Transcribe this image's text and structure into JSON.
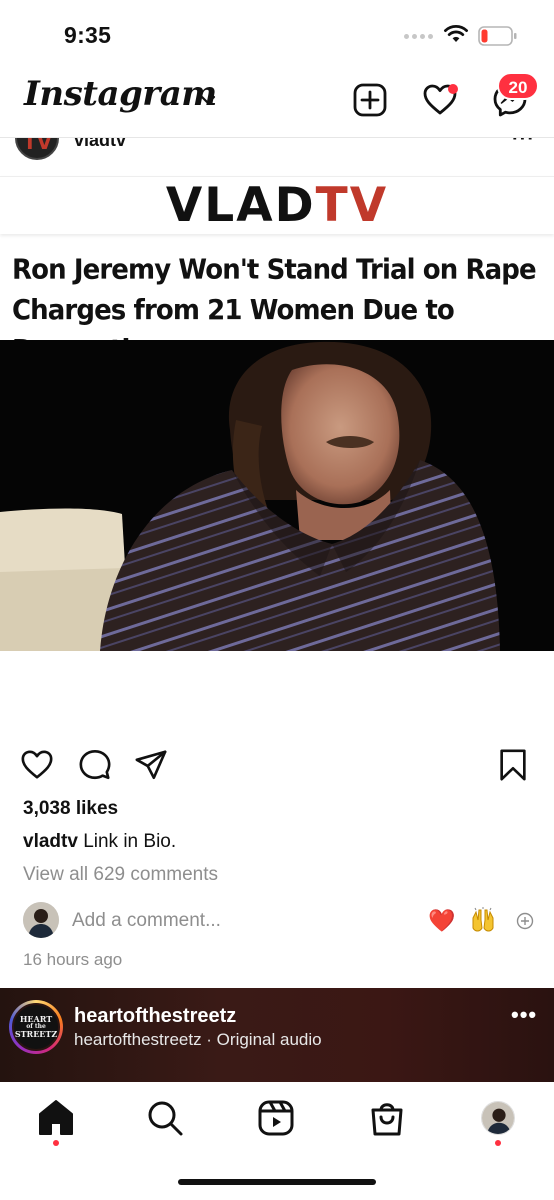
{
  "status_bar": {
    "time": "9:35"
  },
  "header": {
    "logo": "Instagram",
    "messages_badge": "20",
    "icons": [
      "chevron-down-icon",
      "new-post-icon",
      "heart-icon",
      "messenger-icon"
    ]
  },
  "post": {
    "username": "vladtv",
    "media": {
      "brand_vlad": "VLAD",
      "brand_tv": "TV",
      "headline": "Ron Jeremy Won't Stand Trial on Rape Charges from 21 Women Due to Dementia"
    },
    "likes": "3,038 likes",
    "caption_user": "vladtv",
    "caption_text": "Link in Bio.",
    "view_comments": "View all 629 comments",
    "add_comment_placeholder": "Add a comment...",
    "quick_emojis": [
      "❤️",
      "🙌"
    ],
    "timestamp": "16 hours ago"
  },
  "reel_preview": {
    "avatar_text_1": "HEART",
    "avatar_text_2": "of the",
    "avatar_text_3": "STREETZ",
    "username": "heartofthestreetz",
    "audio": "heartofthestreetz · Original audio"
  },
  "tab_bar": {
    "tabs": [
      "home",
      "search",
      "reels",
      "shop",
      "profile"
    ]
  },
  "colors": {
    "accent_red": "#ff3040",
    "brand_tv_red": "#c0392b",
    "secondary_text": "#8e8e8e"
  }
}
